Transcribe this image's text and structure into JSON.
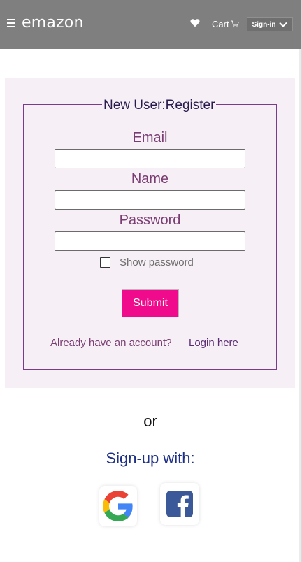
{
  "header": {
    "menu_icon": "hamburger-icon",
    "brand": "emazon",
    "wishlist_icon": "heart-icon",
    "cart_label": "Cart",
    "cart_icon": "cart-icon",
    "signin_label": "Sign-in",
    "signin_icon": "chevron-down-icon",
    "bg_color": "#7f7f7f"
  },
  "form": {
    "legend": "New User:Register",
    "email_label": "Email",
    "email_value": "",
    "name_label": "Name",
    "name_value": "",
    "password_label": "Password",
    "password_value": "",
    "show_password_label": "Show password",
    "show_password_checked": false,
    "submit_label": "Submit",
    "already_text": "Already have an account?",
    "login_link": "Login here",
    "accent_color": "#f00b8c"
  },
  "alt": {
    "or_text": "or",
    "signup_heading": "Sign-up with:",
    "providers": [
      "google-icon",
      "facebook-icon"
    ]
  }
}
